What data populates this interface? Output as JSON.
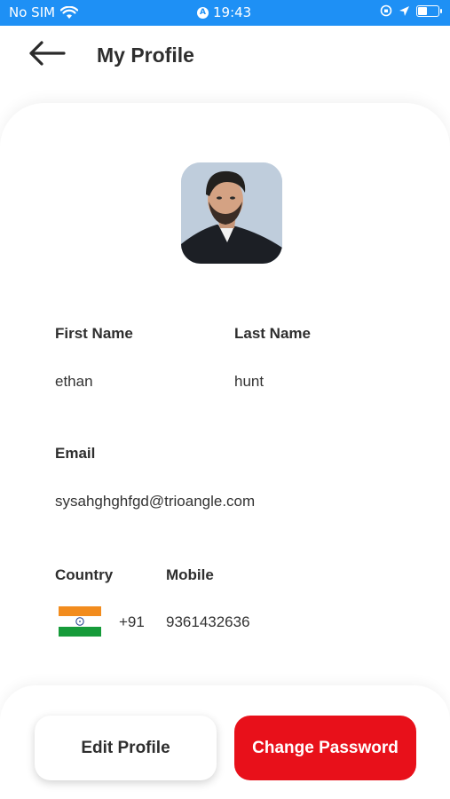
{
  "status_bar": {
    "carrier": "No SIM",
    "time": "19:43",
    "icons": [
      "wifi-icon",
      "location-icon",
      "orientation-lock-icon",
      "navigation-arrow-icon",
      "battery-icon"
    ]
  },
  "header": {
    "title": "My Profile",
    "back_icon": "back-arrow-icon"
  },
  "profile": {
    "avatar_icon": "user-avatar",
    "first_name_label": "First Name",
    "first_name": "ethan",
    "last_name_label": "Last Name",
    "last_name": "hunt",
    "email_label": "Email",
    "email": "sysahghghfgd@trioangle.com",
    "country_label": "Country",
    "country_code": "+91",
    "country_flag": "india-flag-icon",
    "mobile_label": "Mobile",
    "mobile": "9361432636"
  },
  "actions": {
    "edit_label": "Edit Profile",
    "change_password_label": "Change Password"
  },
  "colors": {
    "status_bar": "#1e90f5",
    "accent_red": "#e8101a",
    "text_dark": "#2e2e2e"
  }
}
